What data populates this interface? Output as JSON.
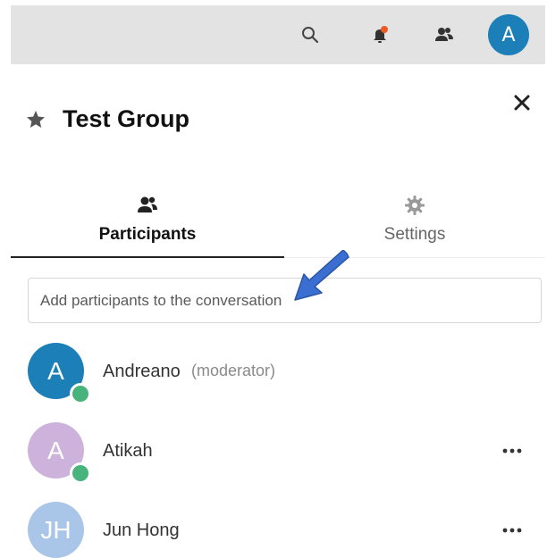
{
  "topbar": {
    "icons": [
      "search-icon",
      "notification-bell-icon",
      "contacts-icon"
    ],
    "notification_dot_color": "#ee5a24",
    "user_avatar_initial": "A",
    "user_avatar_color": "#1d7fb8"
  },
  "conversation": {
    "title": "Test Group",
    "star_icon": "star-icon",
    "close_icon": "close-icon"
  },
  "tabs": [
    {
      "label": "Participants",
      "icon": "participants-icon",
      "active": true
    },
    {
      "label": "Settings",
      "icon": "gear-icon",
      "active": false
    }
  ],
  "search": {
    "placeholder": "Add participants to the conversation"
  },
  "participants": [
    {
      "initial": "A",
      "name": "Andreano",
      "role": "(moderator)",
      "avatar_color": "#1d7fb8",
      "online": true
    },
    {
      "initial": "A",
      "name": "Atikah",
      "role": "",
      "avatar_color": "#cdb3dc",
      "online": true
    },
    {
      "initial": "JH",
      "name": "Jun Hong",
      "role": "",
      "avatar_color": "#a9c6e8",
      "online": false
    }
  ],
  "annotation_arrow_color": "#3a6fd1"
}
